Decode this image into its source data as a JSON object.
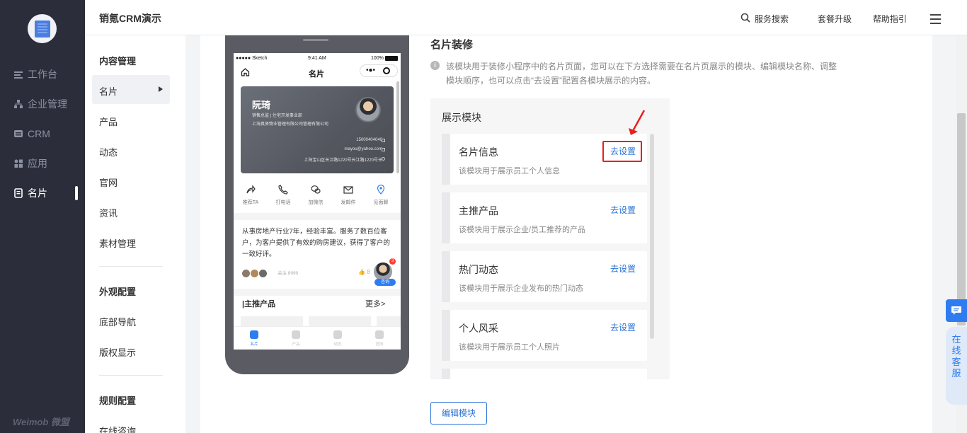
{
  "app": {
    "title": "销氪CRM演示"
  },
  "leftnav": {
    "items": [
      {
        "label": "工作台",
        "icon": "dashboard-icon"
      },
      {
        "label": "企业管理",
        "icon": "org-icon"
      },
      {
        "label": "CRM",
        "icon": "crm-icon"
      },
      {
        "label": "应用",
        "icon": "apps-icon"
      },
      {
        "label": "名片",
        "icon": "card-icon",
        "active": true
      }
    ],
    "brand": "Weimob 微盟"
  },
  "header": {
    "search_label": "服务搜索",
    "upgrade_label": "套餐升级",
    "help_label": "帮助指引"
  },
  "submenu": {
    "group1": "内容管理",
    "items1": [
      "名片",
      "产品",
      "动态",
      "官网",
      "资讯",
      "素材管理"
    ],
    "group2": "外观配置",
    "items2": [
      "底部导航",
      "版权显示"
    ],
    "group3": "规则配置",
    "items3": [
      "在线咨询"
    ]
  },
  "phone": {
    "status": {
      "carrier": "●●●●● Sketch",
      "time": "9:41 AM",
      "battery": "100%"
    },
    "page_title": "名片",
    "card": {
      "name": "阮琦",
      "title": "销售总监 | 住宅开发事业部",
      "company": "上海真贤物业管理有限公司管理有限公司",
      "phone": "15000404040",
      "email": "mayou@yahoo.com",
      "address": "上海宝山区长江路1220号长江路1220号长"
    },
    "actions": [
      "推荐TA",
      "打电话",
      "加微信",
      "发邮件",
      "见面聊"
    ],
    "intro": "从事房地产行业7年，经验丰富。服务了数百位客户，为客户提供了有效的购房建议，获得了客户的一致好评。",
    "follow_text": "关注 8990",
    "like_count": "8",
    "badge": "3",
    "consult": "咨询",
    "products_title": "|主推产品",
    "products_more": "更多>",
    "tabs": [
      "名片",
      "产品",
      "动态",
      "官网"
    ]
  },
  "settings": {
    "title": "名片装修",
    "description": "该模块用于装修小程序中的名片页面，您可以在下方选择需要在名片页展示的模块、编辑模块名称、调整模块顺序，也可以点击“去设置”配置各模块展示的内容。",
    "modules_title": "展示模块",
    "modules": [
      {
        "name": "名片信息",
        "desc": "该模块用于展示员工个人信息",
        "link": "去设置"
      },
      {
        "name": "主推产品",
        "desc": "该模块用于展示企业/员工推荐的产品",
        "link": "去设置"
      },
      {
        "name": "热门动态",
        "desc": "该模块用于展示企业发布的热门动态",
        "link": "去设置"
      },
      {
        "name": "个人风采",
        "desc": "该模块用于展示员工个人照片",
        "link": "去设置"
      }
    ],
    "edit_button": "编辑模块"
  },
  "chat": {
    "label": "在线客服"
  },
  "colors": {
    "accent": "#2a72d6",
    "nav_bg": "#2b2d3a",
    "highlight": "#e8201f"
  }
}
